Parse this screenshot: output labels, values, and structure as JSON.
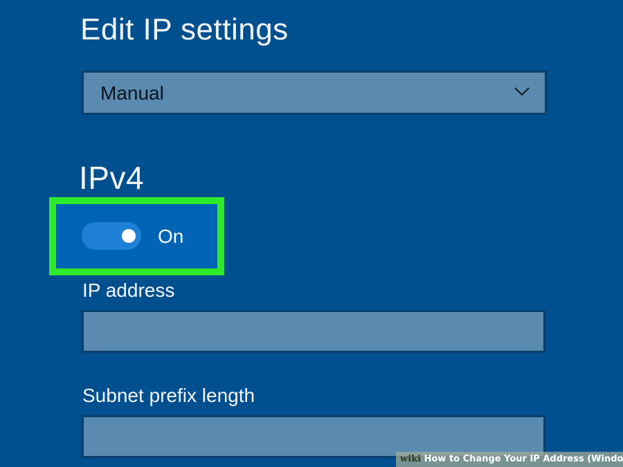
{
  "title": "Edit IP settings",
  "mode_select": {
    "value": "Manual",
    "icon": "chevron-down-icon"
  },
  "ipv4": {
    "heading": "IPv4",
    "toggle": {
      "state_label": "On",
      "on": true
    }
  },
  "fields": {
    "ip_address": {
      "label": "IP address",
      "value": ""
    },
    "subnet_prefix_length": {
      "label": "Subnet prefix length",
      "value": ""
    }
  },
  "watermark": {
    "brand": "wiki",
    "text": "How to Change Your IP Address (Windows)"
  },
  "colors": {
    "background": "#004f8f",
    "field_fill": "#5a8aaf",
    "highlight": "#2fea2a",
    "toggle_on": "#1e80d6"
  }
}
